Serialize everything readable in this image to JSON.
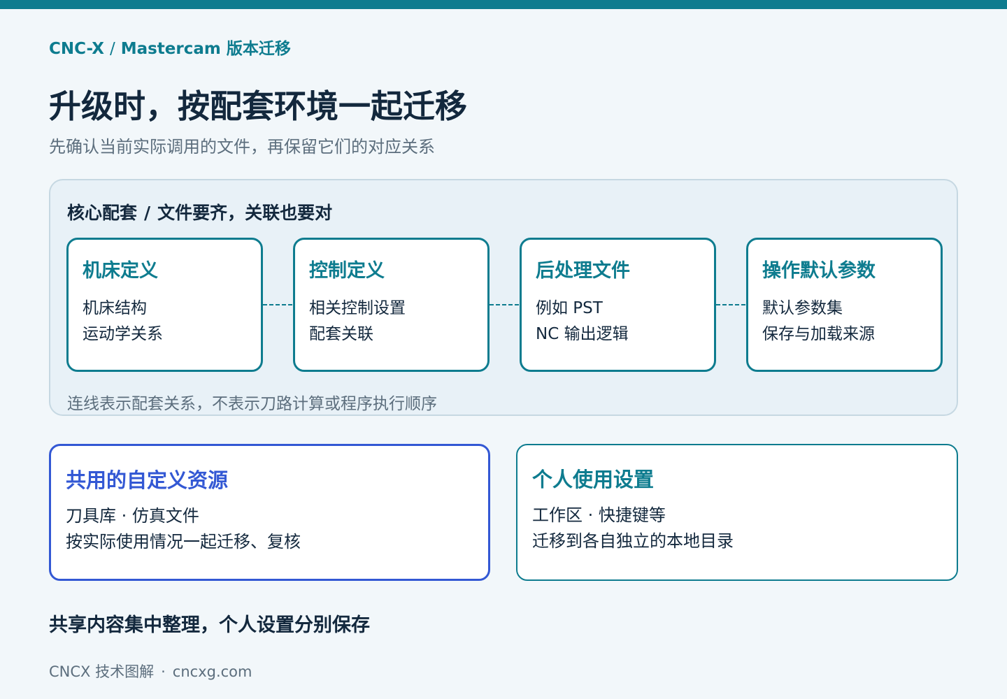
{
  "breadcrumb": {
    "root": "CNC-X",
    "separator": "/",
    "page": "Mastercam 版本迁移"
  },
  "title": "升级时，按配套环境一起迁移",
  "subtitle": "先确认当前实际调用的文件，再保留它们的对应关系",
  "core_panel": {
    "heading_left": "核心配套",
    "heading_separator": "/",
    "heading_right": "文件要齐，关联也要对",
    "cards": [
      {
        "title": "机床定义",
        "lines": [
          "机床结构",
          "运动学关系"
        ]
      },
      {
        "title": "控制定义",
        "lines": [
          "相关控制设置",
          "配套关联"
        ]
      },
      {
        "title": "后处理文件",
        "lines": [
          "例如 PST",
          "NC 输出逻辑"
        ]
      },
      {
        "title": "操作默认参数",
        "lines": [
          "默认参数集",
          "保存与加载来源"
        ]
      }
    ],
    "note": "连线表示配套关系，不表示刀路计算或程序执行顺序"
  },
  "shared_resources": {
    "title": "共用的自定义资源",
    "lines": [
      "刀具库 · 仿真文件",
      "按实际使用情况一起迁移、复核"
    ]
  },
  "personal_settings": {
    "title": "个人使用设置",
    "lines": [
      "工作区 · 快捷键等",
      "迁移到各自独立的本地目录"
    ]
  },
  "summary": "共享内容集中整理，个人设置分别保存",
  "footer": {
    "brand": "CNCX 技术图解",
    "separator": "·",
    "site": "cncxg.com"
  },
  "colors": {
    "accent_teal": "#0e7c8f",
    "accent_blue": "#3358d4",
    "text_dark": "#13283d",
    "text_muted": "#5c6e7d",
    "panel_bg": "#e8f1f7",
    "page_bg": "#f2f7fa"
  }
}
